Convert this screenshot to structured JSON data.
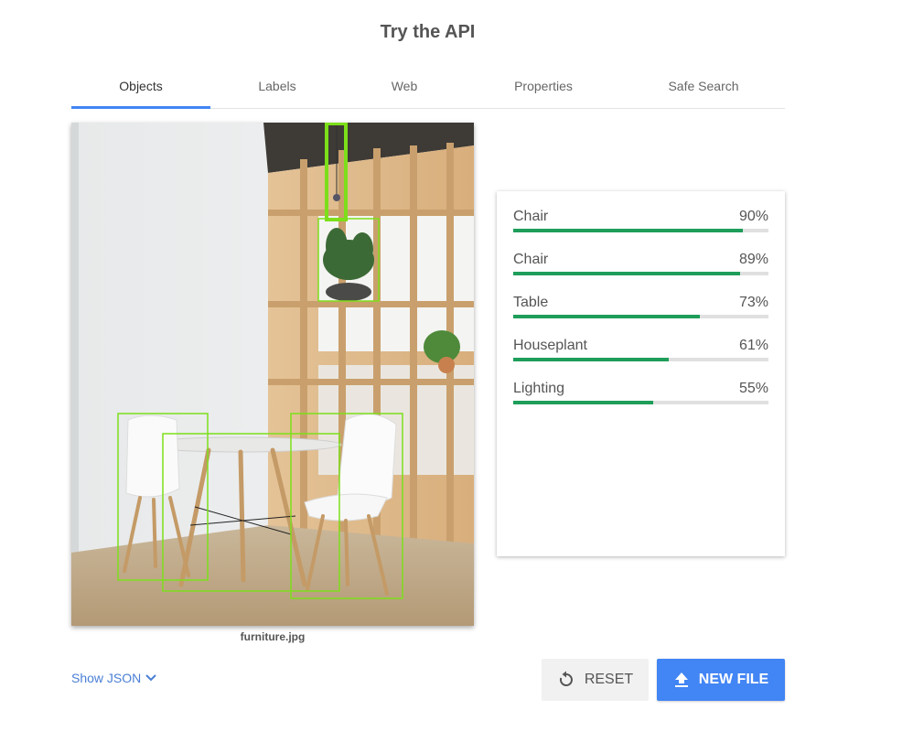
{
  "page": {
    "title": "Try the API"
  },
  "tabs": [
    {
      "label": "Objects",
      "active": true
    },
    {
      "label": "Labels",
      "active": false
    },
    {
      "label": "Web",
      "active": false
    },
    {
      "label": "Properties",
      "active": false
    },
    {
      "label": "Safe Search",
      "active": false
    }
  ],
  "image": {
    "filename": "furniture.jpg"
  },
  "results": [
    {
      "name": "Chair",
      "percent": "90%",
      "score": 0.9
    },
    {
      "name": "Chair",
      "percent": "89%",
      "score": 0.89
    },
    {
      "name": "Table",
      "percent": "73%",
      "score": 0.73
    },
    {
      "name": "Houseplant",
      "percent": "61%",
      "score": 0.61
    },
    {
      "name": "Lighting",
      "percent": "55%",
      "score": 0.55
    }
  ],
  "footer": {
    "show_json": "Show JSON",
    "reset_label": "RESET",
    "new_file_label": "NEW FILE"
  },
  "colors": {
    "accent": "#4285f4",
    "bar": "#1e9e5a",
    "box": "#7cdf1a"
  }
}
